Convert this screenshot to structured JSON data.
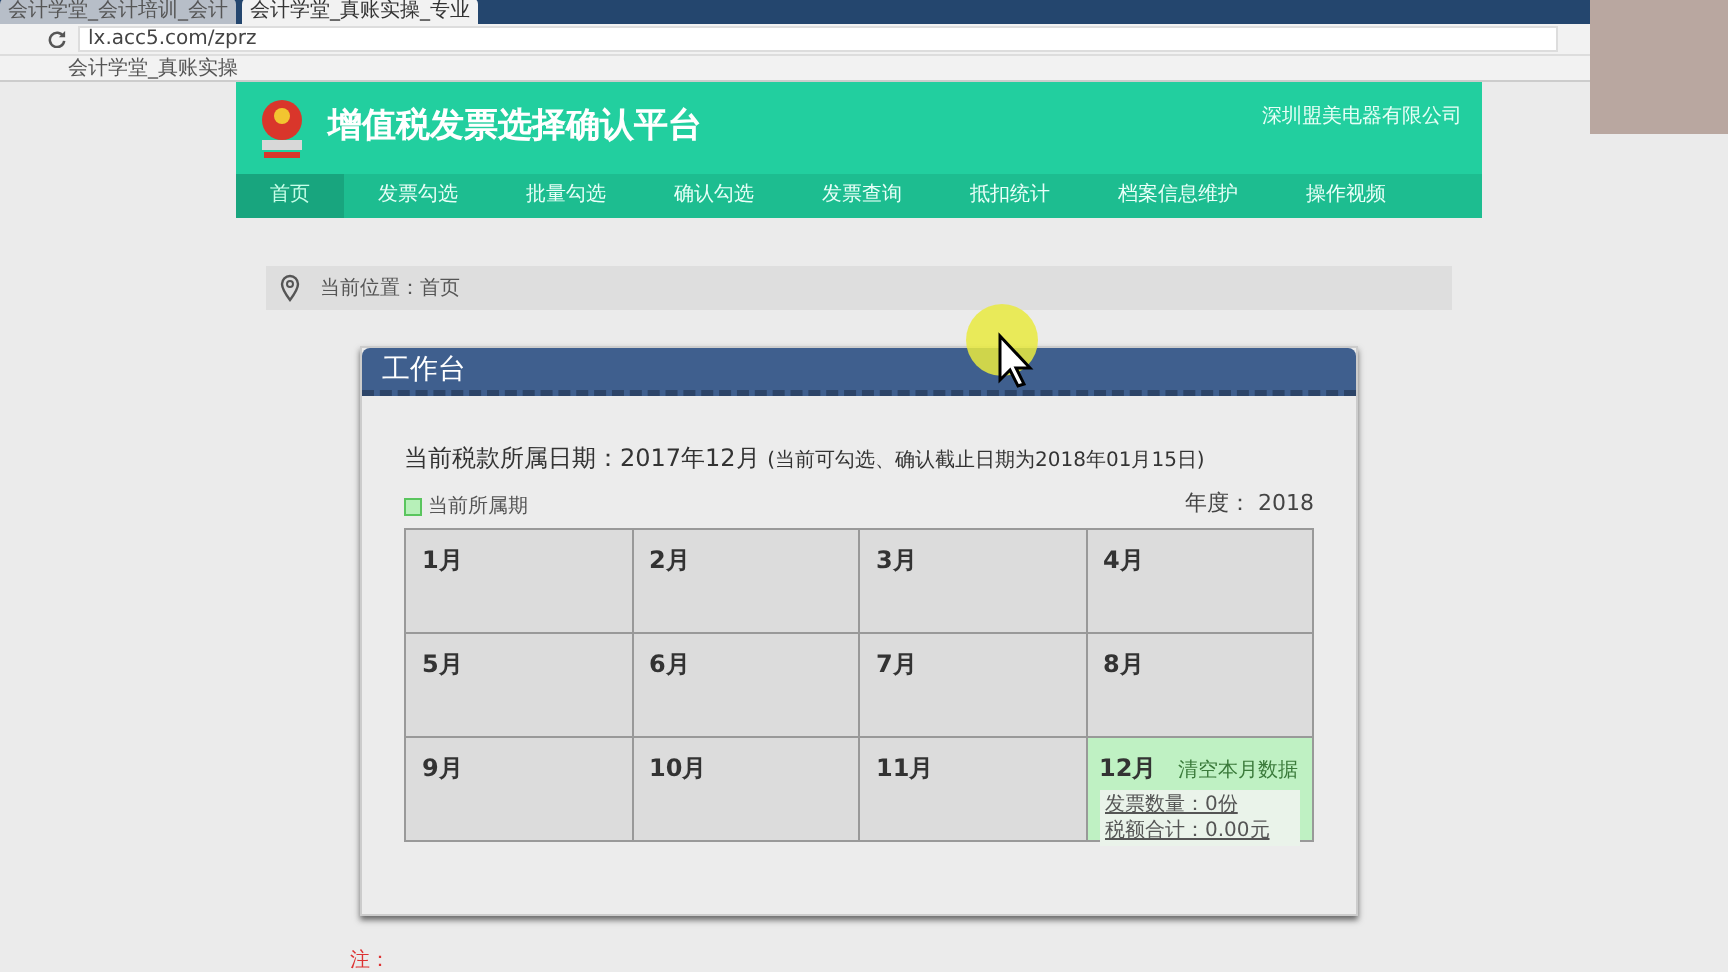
{
  "browser": {
    "tabs": [
      {
        "title": "会计学堂_会计培训_会计",
        "selected": false
      },
      {
        "title": "会计学堂_真账实操_专业",
        "selected": true
      }
    ],
    "address": "lx.acc5.com/zprz",
    "bookmarks": [
      "会计学堂_真账实操"
    ]
  },
  "header": {
    "title": "增值税发票选择确认平台",
    "company": "深圳盟美电器有限公司"
  },
  "nav": [
    {
      "label": "首页",
      "selected": true
    },
    {
      "label": "发票勾选",
      "selected": false
    },
    {
      "label": "批量勾选",
      "selected": false
    },
    {
      "label": "确认勾选",
      "selected": false
    },
    {
      "label": "发票查询",
      "selected": false
    },
    {
      "label": "抵扣统计",
      "selected": false
    },
    {
      "label": "档案信息维护",
      "selected": false
    },
    {
      "label": "操作视频",
      "selected": false
    }
  ],
  "breadcrumb": "当前位置：首页",
  "panel": {
    "title": "工作台",
    "period": "当前税款所属日期：2017年12月",
    "period_note": "(当前可勾选、确认截止日期为2018年01月15日)",
    "legend": "当前所属期",
    "year": "年度： 2018",
    "months": [
      {
        "label": "1月",
        "current": false
      },
      {
        "label": "2月",
        "current": false
      },
      {
        "label": "3月",
        "current": false
      },
      {
        "label": "4月",
        "current": false
      },
      {
        "label": "5月",
        "current": false
      },
      {
        "label": "6月",
        "current": false
      },
      {
        "label": "7月",
        "current": false
      },
      {
        "label": "8月",
        "current": false
      },
      {
        "label": "9月",
        "current": false
      },
      {
        "label": "10月",
        "current": false
      },
      {
        "label": "11月",
        "current": false
      },
      {
        "label": "12月",
        "current": true,
        "action": "清空本月数据",
        "invoice_count": "发票数量：0份",
        "tax_total": "税额合计：0.00元"
      }
    ]
  },
  "note": "注："
}
